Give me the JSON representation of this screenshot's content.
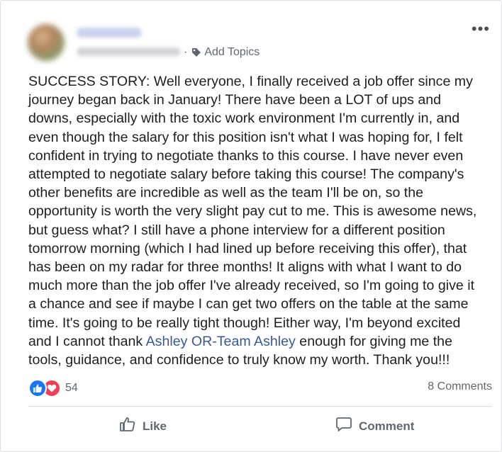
{
  "post": {
    "meta": {
      "separator": "·",
      "add_topics_label": "Add Topics",
      "tag_icon": "tag-icon",
      "more_label": "•••"
    },
    "text_before_link": "SUCCESS STORY: Well everyone, I finally received a job offer since my\njourney began back in January! There have been a LOT of ups and\ndowns, especially with the toxic work environment I'm currently in, and\neven though the salary for this position isn't what I was hoping for, I felt\nconfident in trying to negotiate thanks to this course. I have never even\nattempted to negotiate salary before taking this course! The company's\nother benefits are incredible as well as the team I'll be on, so the\nopportunity is worth the very slight pay cut to me. This is awesome news,\nbut guess what? I still have a phone interview for a different position\ntomorrow morning (which I had lined up before receiving this offer), that\nhas been on my radar for three months! It aligns with what I want to do\nmuch more than the job offer I've already received, so I'm going to give it\na chance and see if maybe I can get two offers on the table at the same\ntime. It's going to be really tight though! Either way, I'm beyond excited\nand I cannot thank ",
    "mention": "Ashley OR-Team Ashley",
    "text_after_link": " enough for giving me the\ntools, guidance, and confidence to truly know my worth. Thank you!!!"
  },
  "stats": {
    "reaction_count": "54",
    "comments_label": "8 Comments",
    "reaction_icons": [
      "like-reaction-icon",
      "love-reaction-icon"
    ]
  },
  "actions": {
    "like_label": "Like",
    "comment_label": "Comment"
  },
  "colors": {
    "link": "#385898",
    "like_blue": "#1877f2",
    "love_red": "#f33e58",
    "muted_text": "#616770"
  }
}
